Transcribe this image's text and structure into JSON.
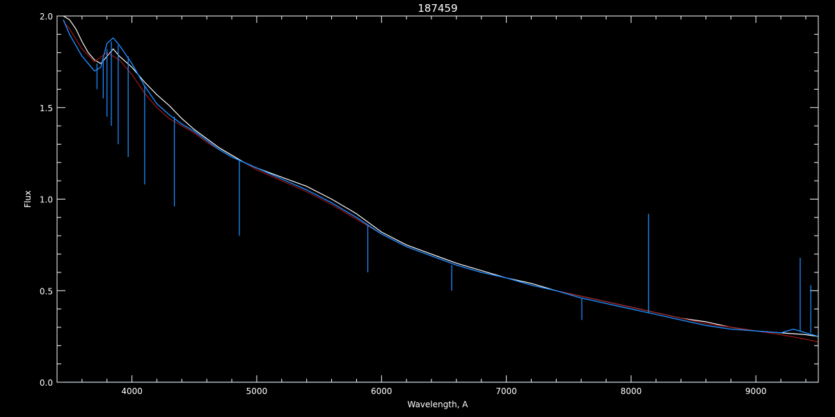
{
  "chart_data": {
    "type": "line",
    "title": "187459",
    "xlabel": "Wavelength, A",
    "ylabel": "Flux",
    "xlim": [
      3400,
      9500
    ],
    "ylim": [
      0.0,
      2.0
    ],
    "x_ticks": [
      4000,
      5000,
      6000,
      7000,
      8000,
      9000
    ],
    "y_ticks": [
      0.0,
      0.5,
      1.0,
      1.5,
      2.0
    ],
    "y_tick_labels": [
      "0.0",
      "0.5",
      "1.0",
      "1.5",
      "2.0"
    ],
    "grid": false,
    "legend": "none",
    "series": [
      {
        "color": "#ffffff",
        "x": [
          3450,
          3500,
          3550,
          3600,
          3650,
          3700,
          3750,
          3800,
          3850,
          3900,
          4000,
          4100,
          4200,
          4300,
          4400,
          4500,
          4600,
          4700,
          4800,
          4900,
          5000,
          5200,
          5400,
          5600,
          5800,
          6000,
          6200,
          6400,
          6600,
          6800,
          7000,
          7200,
          7400,
          7600,
          7800,
          8000,
          8200,
          8400,
          8600,
          8800,
          9000,
          9200,
          9400,
          9500
        ],
        "y": [
          2.0,
          1.98,
          1.93,
          1.86,
          1.8,
          1.76,
          1.74,
          1.78,
          1.82,
          1.78,
          1.72,
          1.64,
          1.57,
          1.51,
          1.44,
          1.38,
          1.33,
          1.28,
          1.24,
          1.2,
          1.17,
          1.12,
          1.07,
          1.0,
          0.92,
          0.82,
          0.75,
          0.7,
          0.65,
          0.61,
          0.57,
          0.54,
          0.5,
          0.47,
          0.44,
          0.41,
          0.38,
          0.35,
          0.33,
          0.3,
          0.28,
          0.27,
          0.26,
          0.25
        ]
      },
      {
        "color": "#a01818",
        "x": [
          3450,
          3500,
          3600,
          3700,
          3800,
          3900,
          4000,
          4100,
          4200,
          4300,
          4400,
          4500,
          4600,
          4700,
          4800,
          4900,
          5000,
          5200,
          5400,
          5600,
          5800,
          6000,
          6200,
          6400,
          6600,
          6800,
          7000,
          7200,
          7400,
          7600,
          7800,
          8000,
          8200,
          8400,
          8600,
          8800,
          9000,
          9200,
          9400,
          9500
        ],
        "y": [
          1.97,
          1.93,
          1.82,
          1.75,
          1.8,
          1.76,
          1.68,
          1.58,
          1.5,
          1.44,
          1.4,
          1.36,
          1.31,
          1.27,
          1.23,
          1.2,
          1.16,
          1.1,
          1.04,
          0.97,
          0.89,
          0.81,
          0.74,
          0.69,
          0.64,
          0.6,
          0.57,
          0.53,
          0.5,
          0.47,
          0.44,
          0.41,
          0.38,
          0.35,
          0.32,
          0.3,
          0.28,
          0.26,
          0.235,
          0.22
        ]
      },
      {
        "color": "#1e8cff",
        "x": [
          3450,
          3500,
          3550,
          3600,
          3650,
          3700,
          3750,
          3800,
          3850,
          3900,
          4000,
          4100,
          4200,
          4300,
          4400,
          4500,
          4600,
          4700,
          4800,
          4900,
          5000,
          5200,
          5400,
          5600,
          5800,
          6000,
          6200,
          6400,
          6600,
          6800,
          7000,
          7200,
          7400,
          7600,
          7800,
          8000,
          8200,
          8400,
          8600,
          8800,
          9000,
          9200,
          9300,
          9400,
          9500
        ],
        "y": [
          1.98,
          1.9,
          1.84,
          1.78,
          1.74,
          1.7,
          1.72,
          1.85,
          1.88,
          1.84,
          1.74,
          1.62,
          1.52,
          1.46,
          1.41,
          1.37,
          1.32,
          1.27,
          1.23,
          1.2,
          1.17,
          1.11,
          1.05,
          0.98,
          0.9,
          0.81,
          0.74,
          0.69,
          0.64,
          0.6,
          0.57,
          0.53,
          0.5,
          0.46,
          0.43,
          0.4,
          0.37,
          0.34,
          0.31,
          0.29,
          0.28,
          0.27,
          0.29,
          0.27,
          0.25
        ]
      },
      {
        "color": "#1e8cff",
        "x": [
          3450,
          9500
        ],
        "y": [
          0.0,
          0.0
        ]
      }
    ],
    "spikes": [
      {
        "x": 3720,
        "y0": 1.74,
        "y1": 1.6,
        "color": "#1e8cff"
      },
      {
        "x": 3770,
        "y0": 1.76,
        "y1": 1.55,
        "color": "#1e8cff"
      },
      {
        "x": 3800,
        "y0": 1.82,
        "y1": 1.45,
        "color": "#1e8cff"
      },
      {
        "x": 3835,
        "y0": 1.86,
        "y1": 1.4,
        "color": "#1e8cff"
      },
      {
        "x": 3890,
        "y0": 1.84,
        "y1": 1.3,
        "color": "#1e8cff"
      },
      {
        "x": 3970,
        "y0": 1.78,
        "y1": 1.23,
        "color": "#1e8cff"
      },
      {
        "x": 4102,
        "y0": 1.62,
        "y1": 1.08,
        "color": "#1e8cff"
      },
      {
        "x": 4340,
        "y0": 1.45,
        "y1": 0.96,
        "color": "#1e8cff"
      },
      {
        "x": 4861,
        "y0": 1.21,
        "y1": 0.8,
        "color": "#1e8cff"
      },
      {
        "x": 5890,
        "y0": 0.86,
        "y1": 0.6,
        "color": "#1e8cff"
      },
      {
        "x": 6563,
        "y0": 0.64,
        "y1": 0.5,
        "color": "#1e8cff"
      },
      {
        "x": 7605,
        "y0": 0.46,
        "y1": 0.34,
        "color": "#1e8cff"
      },
      {
        "x": 8140,
        "y0": 0.38,
        "y1": 0.92,
        "color": "#1e8cff"
      },
      {
        "x": 9355,
        "y0": 0.28,
        "y1": 0.68,
        "color": "#1e8cff"
      },
      {
        "x": 9440,
        "y0": 0.27,
        "y1": 0.53,
        "color": "#1e8cff"
      }
    ]
  }
}
